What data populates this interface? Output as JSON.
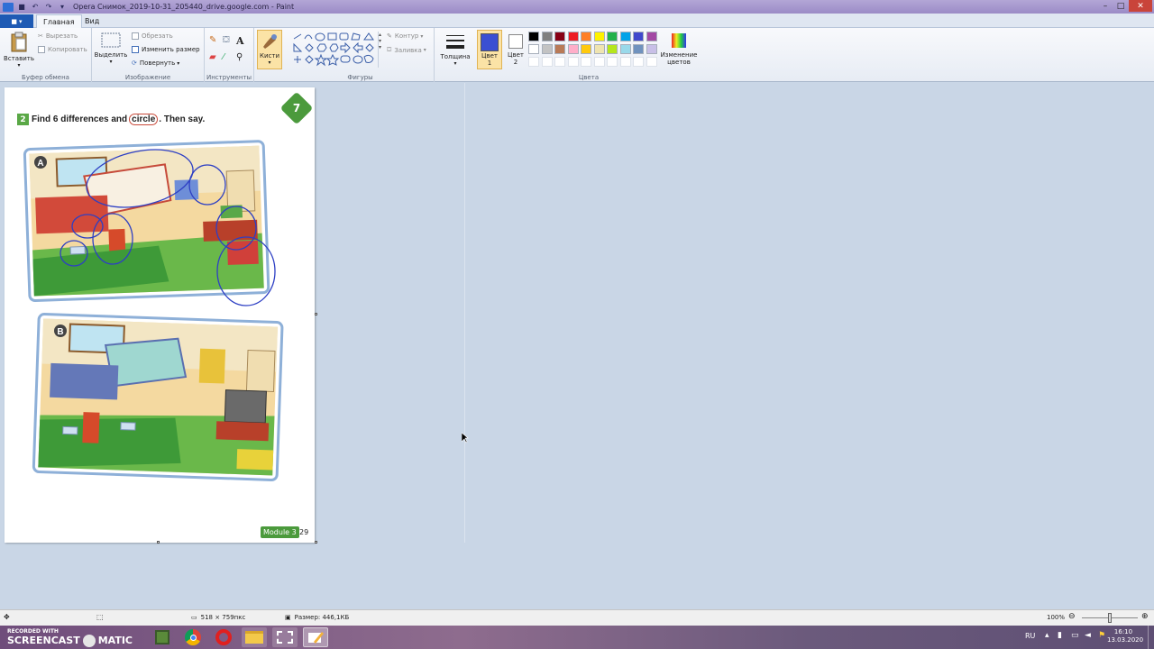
{
  "window": {
    "title": "Opera Снимок_2019-10-31_205440_drive.google.com - Paint"
  },
  "ribbon": {
    "file_tab": "▾",
    "tabs": [
      "Главная",
      "Вид"
    ],
    "clipboard": {
      "paste": "Вставить",
      "cut": "Вырезать",
      "copy": "Копировать",
      "label": "Буфер обмена"
    },
    "image": {
      "select": "Выделить",
      "crop": "Обрезать",
      "resize": "Изменить размер",
      "rotate": "Повернуть",
      "label": "Изображение"
    },
    "tools": {
      "label": "Инструменты"
    },
    "brushes": {
      "label": "Кисти"
    },
    "shapes": {
      "outline": "Контур",
      "fill": "Заливка",
      "label": "Фигуры"
    },
    "thickness": {
      "label": "Толщина"
    },
    "colors": {
      "color1": "Цвет 1",
      "color2": "Цвет 2",
      "edit": "Изменение цветов",
      "label": "Цвета",
      "color1_value": "#3a4fd2",
      "color2_value": "#ffffff",
      "palette_row1": [
        "#000000",
        "#7f7f7f",
        "#880015",
        "#ed1c24",
        "#ff7f27",
        "#fff200",
        "#22b14c",
        "#00a2e8",
        "#3f48cc",
        "#a349a4"
      ],
      "palette_row2": [
        "#ffffff",
        "#c3c3c3",
        "#b97a57",
        "#ffaec9",
        "#ffc90e",
        "#efe4b0",
        "#b5e61d",
        "#99d9ea",
        "#7092be",
        "#c8bfe7"
      ]
    }
  },
  "worksheet": {
    "task_number": "2",
    "instruction_before": "Find 6 differences and",
    "instruction_circled": "circle",
    "instruction_after": ". Then say.",
    "page_badge": "7",
    "picture_a": "A",
    "picture_b": "B",
    "module_label": "Module 3",
    "page_number": "29"
  },
  "status": {
    "dimensions": "518 × 759пкс",
    "size": "Размер: 446,1КБ",
    "zoom": "100%",
    "zoom_level": 0.5
  },
  "watermark": {
    "line1": "RECORDED WITH",
    "line2": "SCREENCAST",
    "line3": "MATIC"
  },
  "tray": {
    "lang": "RU",
    "time": "16:10",
    "date": "13.03.2020"
  }
}
